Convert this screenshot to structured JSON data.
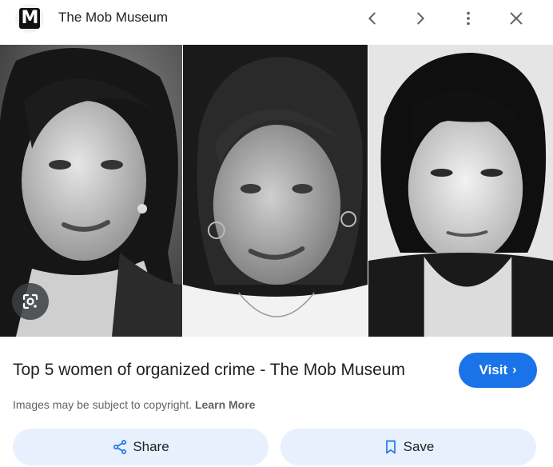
{
  "header": {
    "logo_letter": "M",
    "site_name": "The Mob Museum",
    "icons": [
      "chevron-left-icon",
      "chevron-right-icon",
      "more-vert-icon",
      "close-icon"
    ]
  },
  "images": [
    {
      "name": "woman-photo-1"
    },
    {
      "name": "woman-photo-2"
    },
    {
      "name": "woman-photo-3"
    }
  ],
  "lens_icon": "google-lens-icon",
  "result": {
    "title": "Top 5 women of organized crime - The Mob Museum",
    "visit_label": "Visit",
    "visit_chevron": "›",
    "copyright_text": "Images may be subject to copyright.",
    "learn_more": "Learn More"
  },
  "actions": {
    "share_label": "Share",
    "save_label": "Save"
  },
  "colors": {
    "accent": "#1a73e8",
    "button_bg": "#e8f0fe"
  }
}
